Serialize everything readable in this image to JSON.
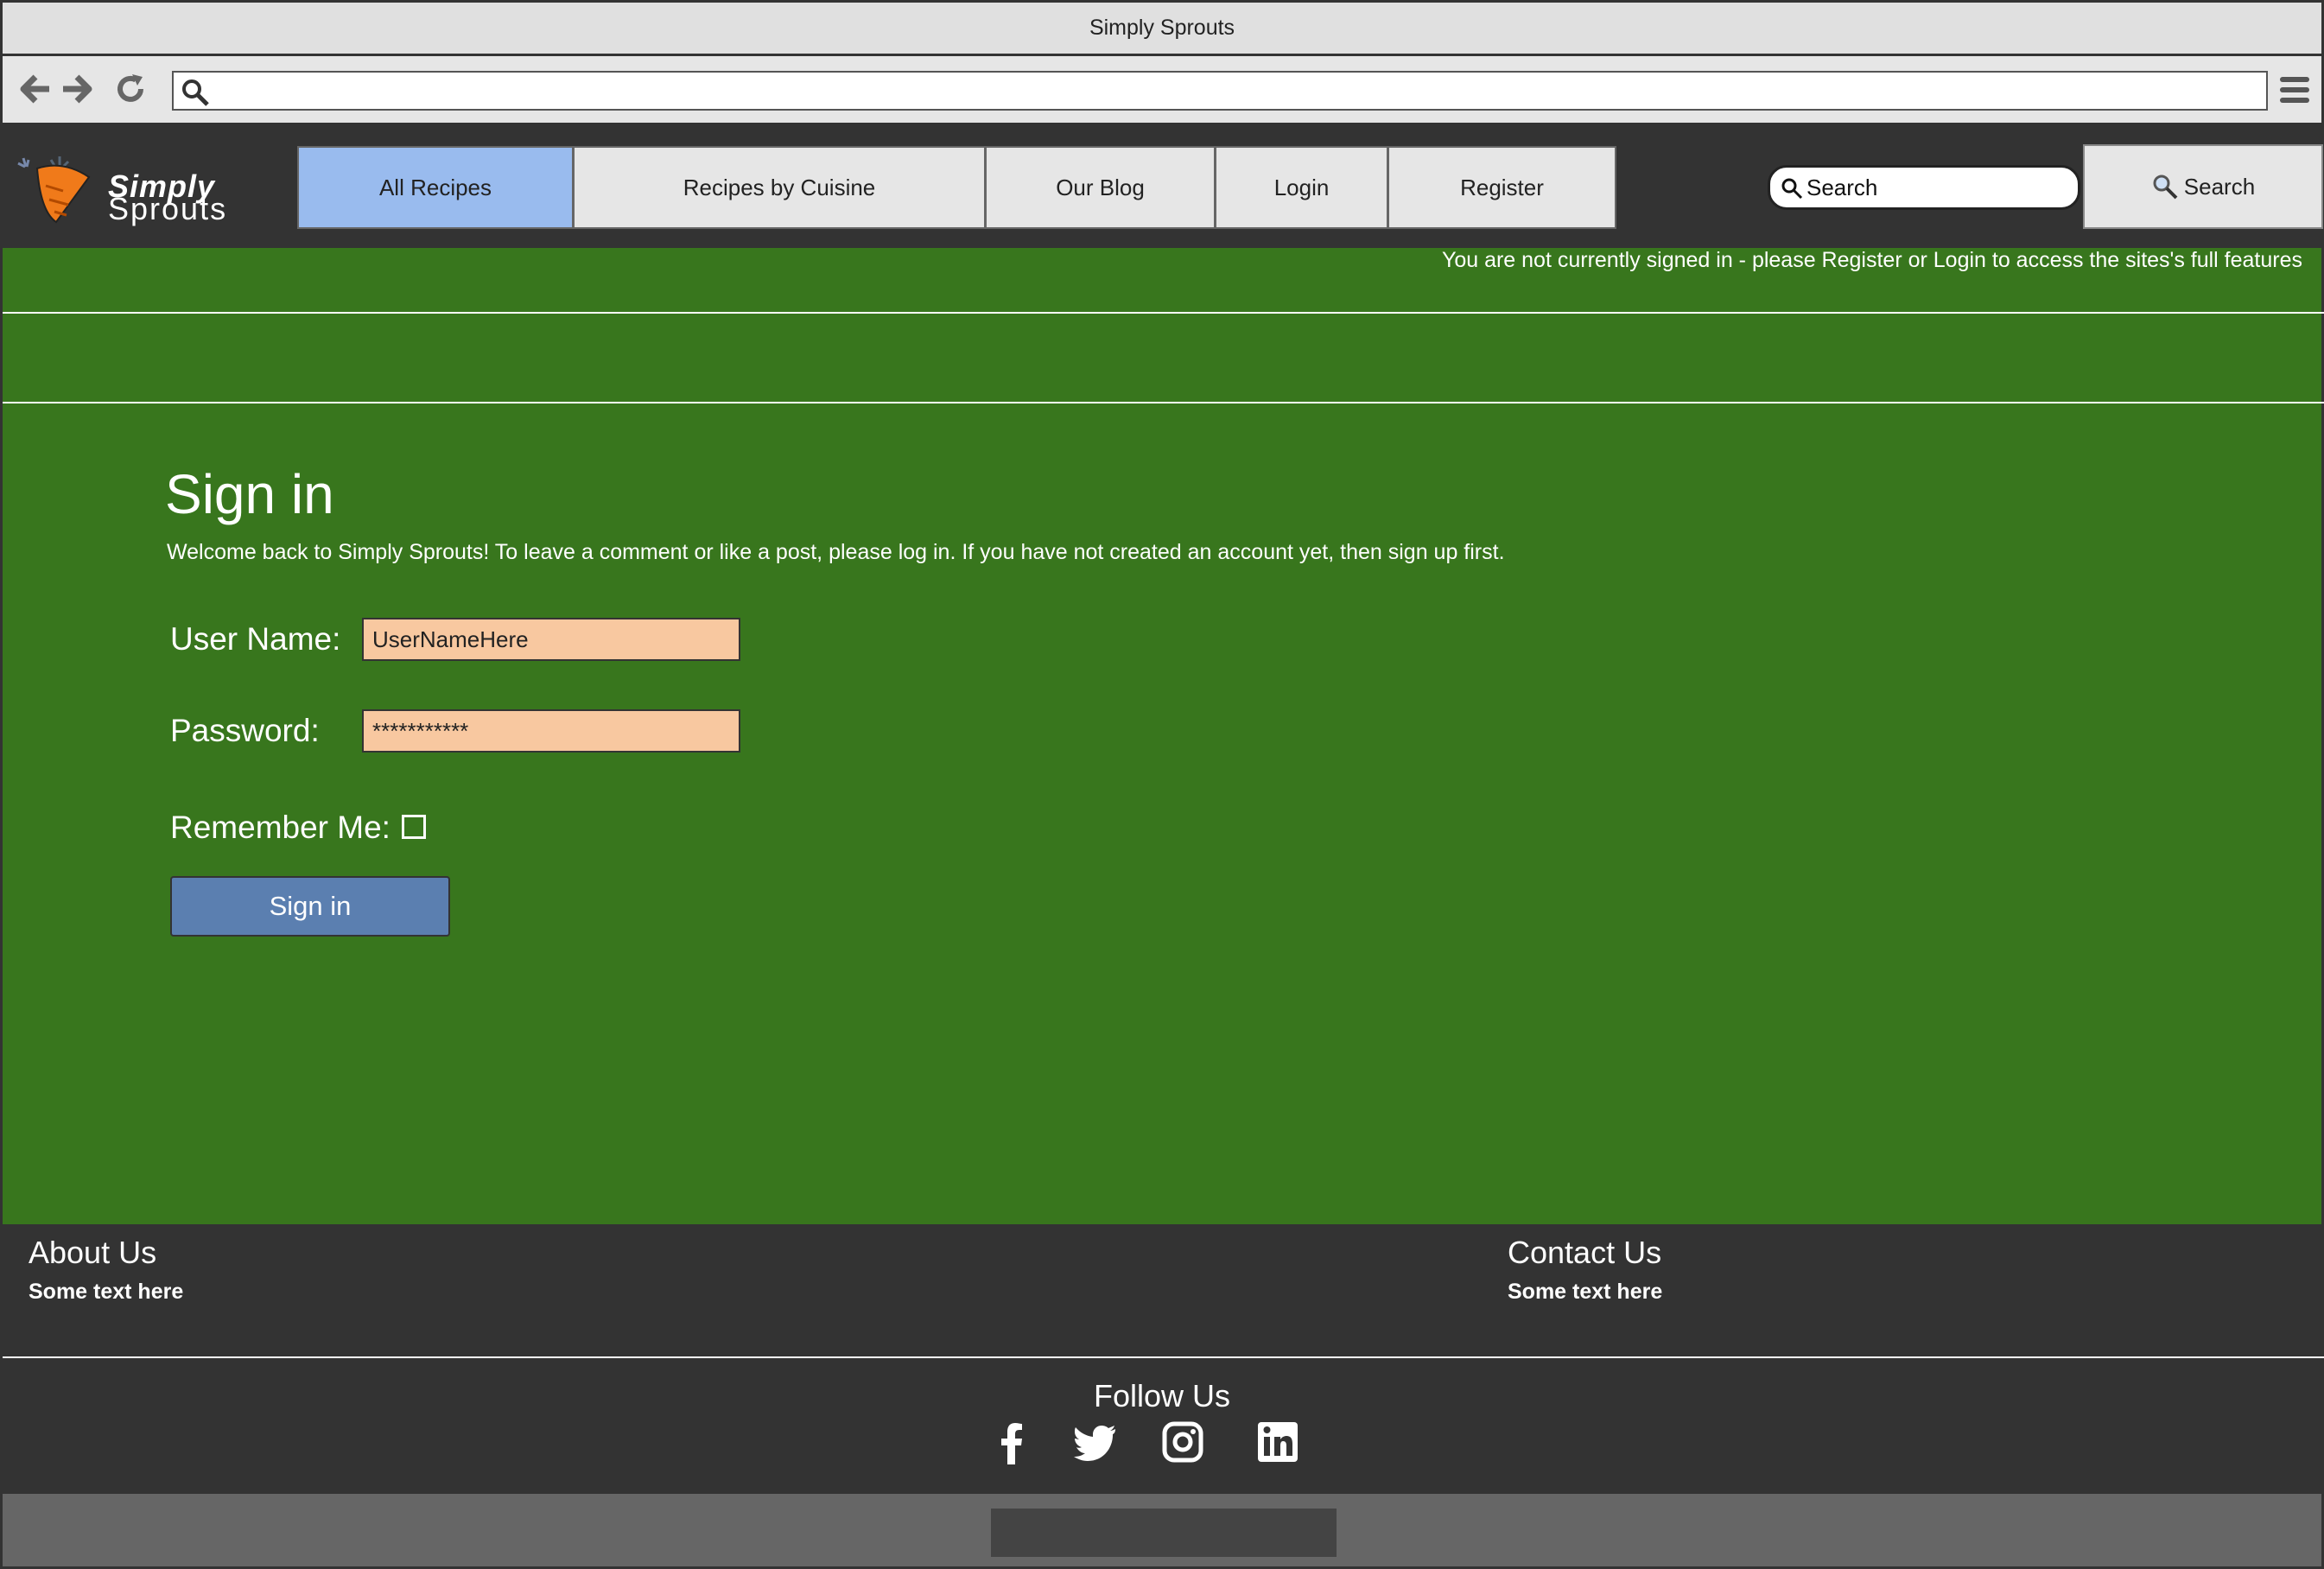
{
  "window": {
    "title": "Simply Sprouts"
  },
  "browser": {
    "back_icon": "arrow-left-icon",
    "forward_icon": "arrow-right-icon",
    "reload_icon": "reload-icon",
    "url": "",
    "menu_icon": "hamburger-menu-icon"
  },
  "logo": {
    "line1": "Simply",
    "line2": "Sprouts"
  },
  "nav": {
    "tabs": [
      {
        "label": "All Recipes",
        "active": true
      },
      {
        "label": "Recipes by Cuisine",
        "active": false
      },
      {
        "label": "Our Blog",
        "active": false
      },
      {
        "label": "Login",
        "active": false
      },
      {
        "label": "Register",
        "active": false
      }
    ]
  },
  "search": {
    "placeholder": "Search",
    "button_label": "Search"
  },
  "notice": "You are not currently signed in - please Register or Login to access the sites's full features",
  "signin": {
    "title": "Sign in",
    "welcome": "Welcome back to Simply Sprouts! To leave a comment or like a post, please log in. If you have not created an account yet, then sign up first.",
    "username_label": "User Name:",
    "username_value": "UserNameHere",
    "password_label": "Password:",
    "password_value": "***********",
    "remember_label": "Remember Me:",
    "remember_checked": false,
    "button_label": "Sign in"
  },
  "footer": {
    "about_title": "About Us",
    "about_text": "Some text here",
    "contact_title": "Contact Us",
    "contact_text": "Some text here",
    "follow_title": "Follow Us",
    "social": [
      "facebook-icon",
      "twitter-icon",
      "instagram-icon",
      "linkedin-icon"
    ]
  },
  "colors": {
    "main_bg": "#38761d",
    "header_bg": "#333333",
    "active_tab": "#99bbee",
    "input_bg": "#f8c8a0",
    "signin_button": "#5b7fb0"
  }
}
